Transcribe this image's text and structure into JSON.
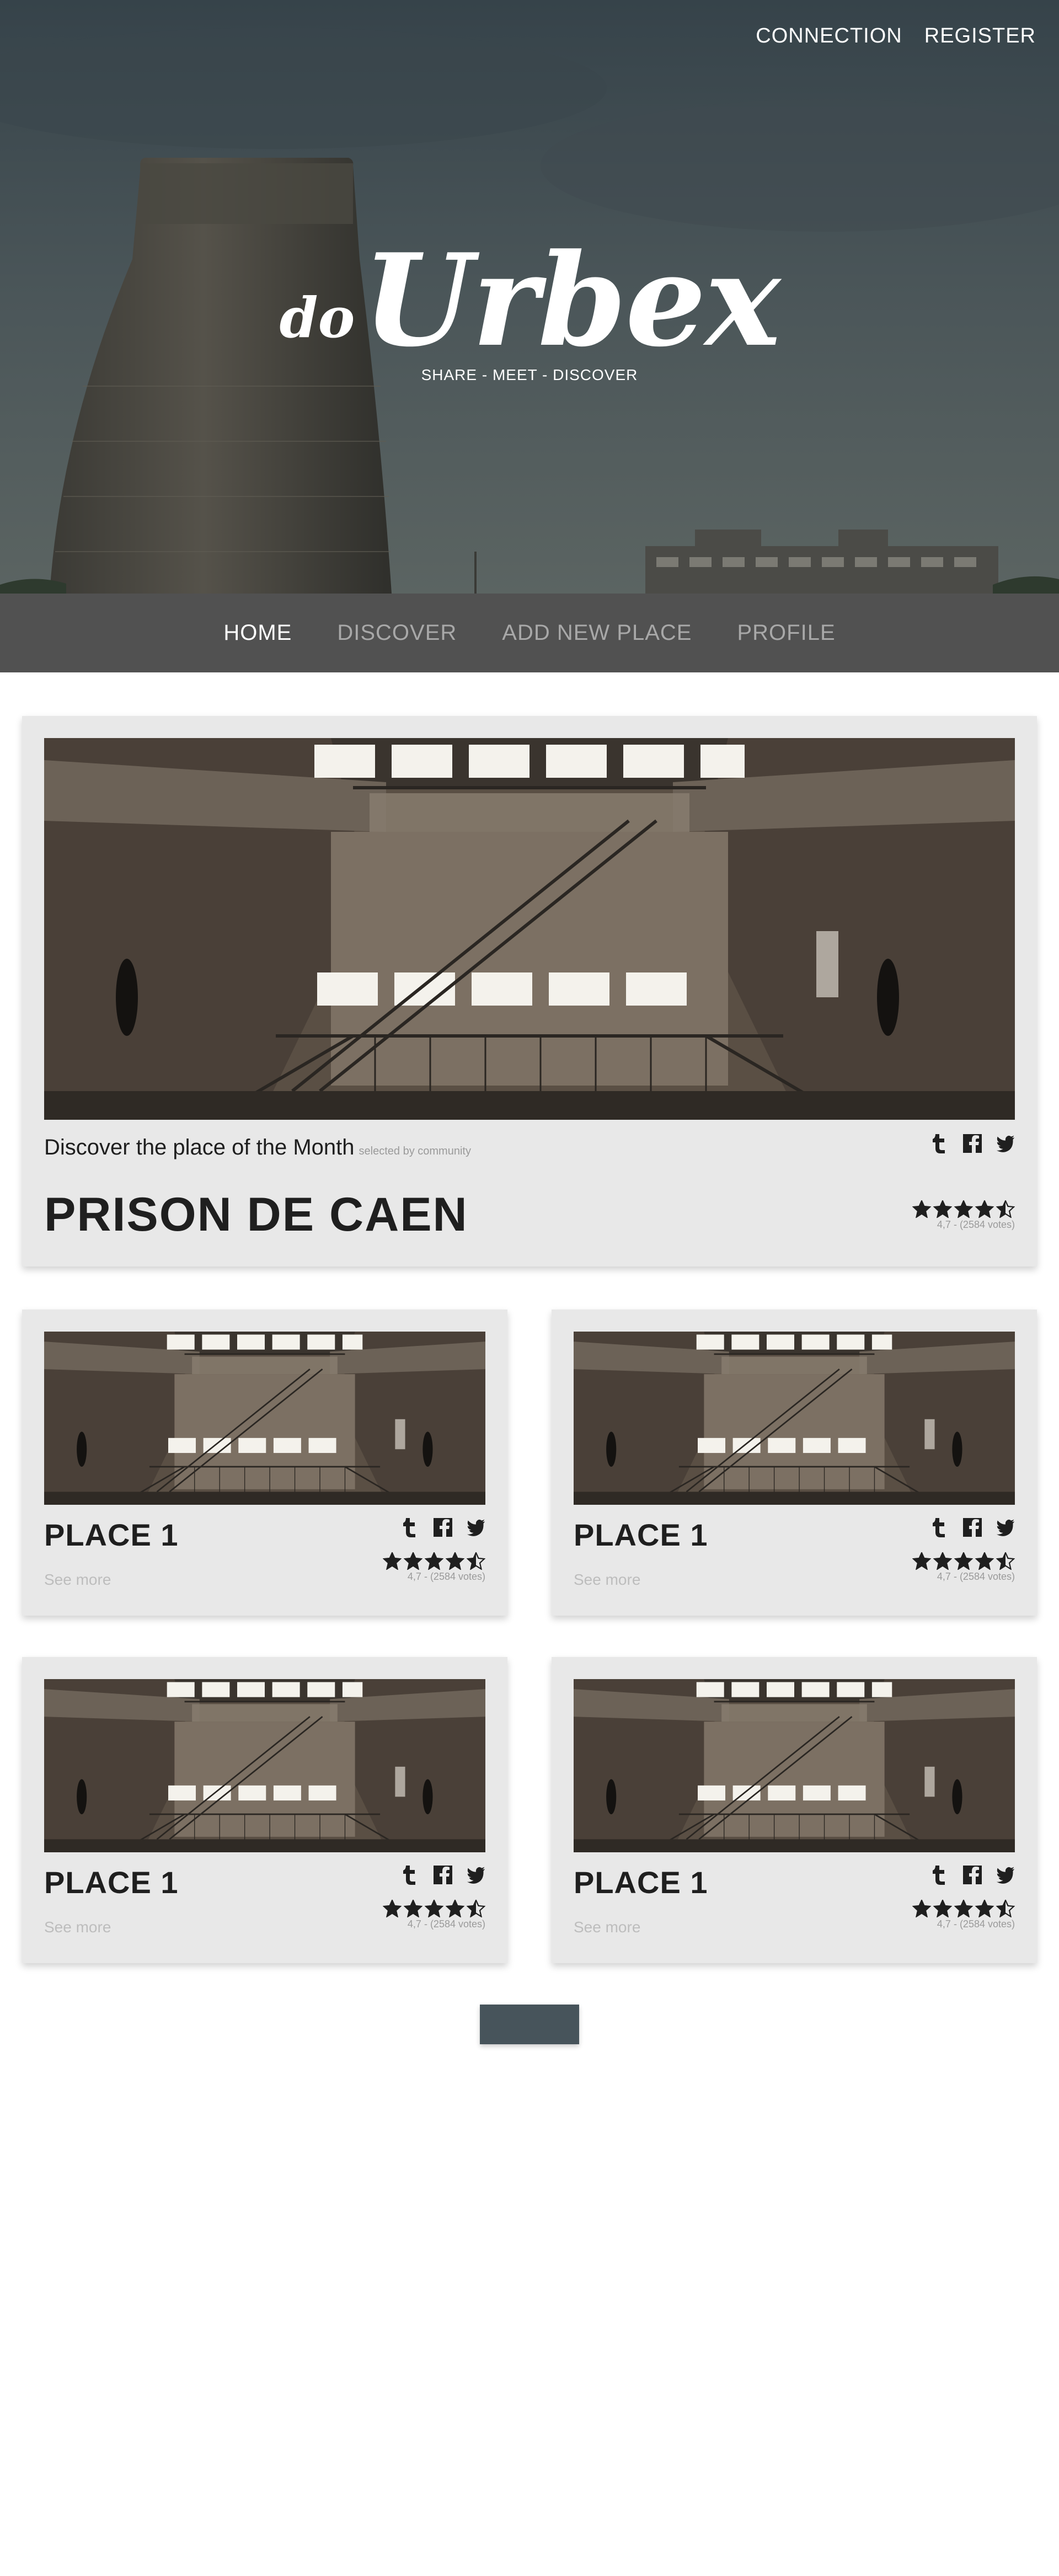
{
  "header": {
    "auth": {
      "connection": "CONNECTION",
      "register": "REGISTER"
    },
    "logo": {
      "prefix": "do",
      "word": "Urbex"
    },
    "tagline": "SHARE - MEET - DISCOVER"
  },
  "nav": {
    "items": [
      {
        "label": "HOME",
        "active": true
      },
      {
        "label": "DISCOVER",
        "active": false
      },
      {
        "label": "ADD NEW PLACE",
        "active": false
      },
      {
        "label": "PROFILE",
        "active": false
      }
    ]
  },
  "featured": {
    "caption": "Discover the place of the Month",
    "caption_note": "selected by community",
    "title": "PRISON DE CAEN",
    "rating": 4.5,
    "votes": "4,7 - (2584 votes)"
  },
  "places": [
    {
      "name": "PLACE 1",
      "see_more": "See more",
      "rating": 4.5,
      "votes": "4,7 - (2584 votes)"
    },
    {
      "name": "PLACE 1",
      "see_more": "See more",
      "rating": 4.5,
      "votes": "4,7 - (2584 votes)"
    },
    {
      "name": "PLACE 1",
      "see_more": "See more",
      "rating": 4.5,
      "votes": "4,7 - (2584 votes)"
    },
    {
      "name": "PLACE 1",
      "see_more": "See more",
      "rating": 4.5,
      "votes": "4,7 - (2584 votes)"
    }
  ],
  "social_icons": [
    "tumblr-icon",
    "facebook-icon",
    "twitter-icon"
  ],
  "colors": {
    "nav_bg": "#515151",
    "card_bg": "#e8e8e8",
    "button_bg": "#47545b",
    "text_dark": "#1f1f1f",
    "text_muted": "#9a9a9a"
  }
}
